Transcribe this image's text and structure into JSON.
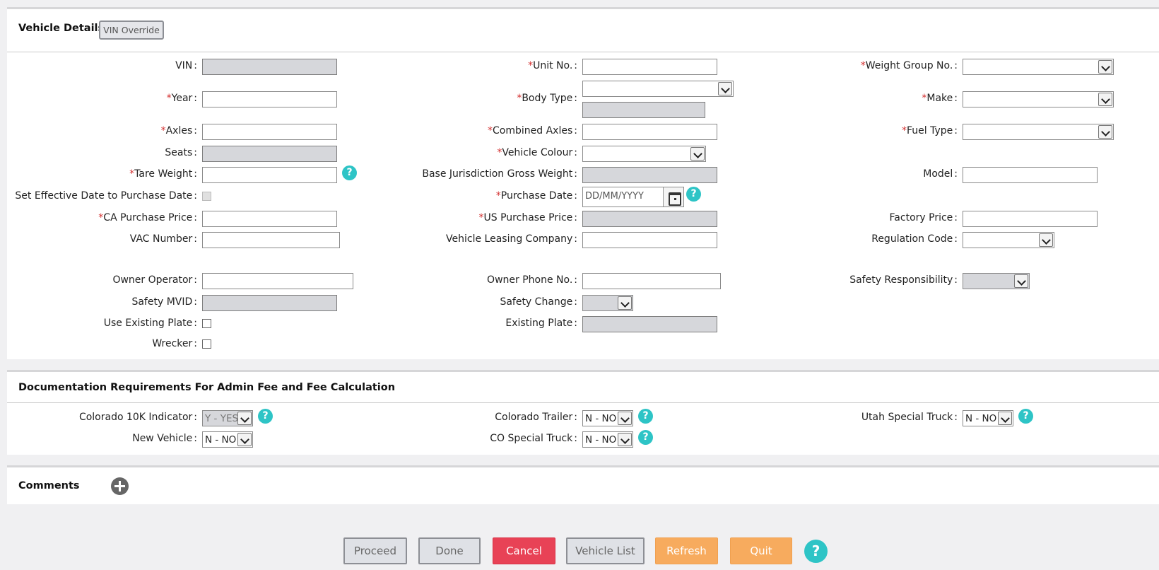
{
  "vehicle_details": {
    "title": "Vehicle Details",
    "vin_override_label": "VIN Override",
    "fields": {
      "vin": {
        "label": "VIN",
        "value": ""
      },
      "unit_no": {
        "label": "Unit No.",
        "value": ""
      },
      "weight_group_no": {
        "label": "Weight Group No.",
        "value": ""
      },
      "year": {
        "label": "Year",
        "value": ""
      },
      "body_type": {
        "label": "Body Type",
        "value": ""
      },
      "make": {
        "label": "Make",
        "value": ""
      },
      "axles": {
        "label": "Axles",
        "value": ""
      },
      "combined_axles": {
        "label": "Combined Axles",
        "value": ""
      },
      "fuel_type": {
        "label": "Fuel Type",
        "value": ""
      },
      "seats": {
        "label": "Seats",
        "value": ""
      },
      "vehicle_colour": {
        "label": "Vehicle Colour",
        "value": ""
      },
      "tare_weight": {
        "label": "Tare Weight",
        "value": ""
      },
      "base_jurisdiction_gross_weight": {
        "label": "Base Jurisdiction Gross Weight",
        "value": ""
      },
      "model": {
        "label": "Model",
        "value": ""
      },
      "set_effective_date": {
        "label": "Set Effective Date to Purchase Date",
        "checked": false
      },
      "purchase_date": {
        "label": "Purchase Date",
        "placeholder": "DD/MM/YYYY"
      },
      "ca_purchase_price": {
        "label": "CA Purchase Price",
        "value": ""
      },
      "us_purchase_price": {
        "label": "US Purchase Price",
        "value": ""
      },
      "factory_price": {
        "label": "Factory Price",
        "value": ""
      },
      "vac_number": {
        "label": "VAC Number",
        "value": ""
      },
      "vehicle_leasing_company": {
        "label": "Vehicle Leasing Company",
        "value": ""
      },
      "regulation_code": {
        "label": "Regulation Code",
        "value": ""
      },
      "owner_operator": {
        "label": "Owner Operator",
        "value": ""
      },
      "owner_phone_no": {
        "label": "Owner Phone No.",
        "value": ""
      },
      "safety_responsibility": {
        "label": "Safety Responsibility",
        "value": ""
      },
      "safety_mvid": {
        "label": "Safety MVID",
        "value": ""
      },
      "safety_change": {
        "label": "Safety Change",
        "value": ""
      },
      "use_existing_plate": {
        "label": "Use Existing Plate",
        "checked": false
      },
      "existing_plate": {
        "label": "Existing Plate",
        "value": ""
      },
      "wrecker": {
        "label": "Wrecker",
        "checked": false
      }
    }
  },
  "documentation": {
    "title": "Documentation Requirements For Admin Fee and Fee Calculation",
    "fields": {
      "colorado_10k": {
        "label": "Colorado 10K Indicator",
        "value": "Y - YES"
      },
      "colorado_trailer": {
        "label": "Colorado Trailer",
        "value": "N - NO"
      },
      "utah_special_truck": {
        "label": "Utah Special Truck",
        "value": "N - NO"
      },
      "new_vehicle": {
        "label": "New Vehicle",
        "value": "N - NO"
      },
      "co_special_truck": {
        "label": "CO Special Truck",
        "value": "N - NO"
      }
    }
  },
  "comments": {
    "title": "Comments"
  },
  "actions": {
    "proceed": "Proceed",
    "done": "Done",
    "cancel": "Cancel",
    "vehicle_list": "Vehicle List",
    "refresh": "Refresh",
    "quit": "Quit"
  },
  "symbols": {
    "colon": ":",
    "required": "*",
    "help": "?"
  },
  "colors": {
    "required": "#d32f2f",
    "help": "#2ec4c6",
    "cancel": "#e84256",
    "orange": "#f7ab5e",
    "disabled_field": "#d6d7db"
  }
}
